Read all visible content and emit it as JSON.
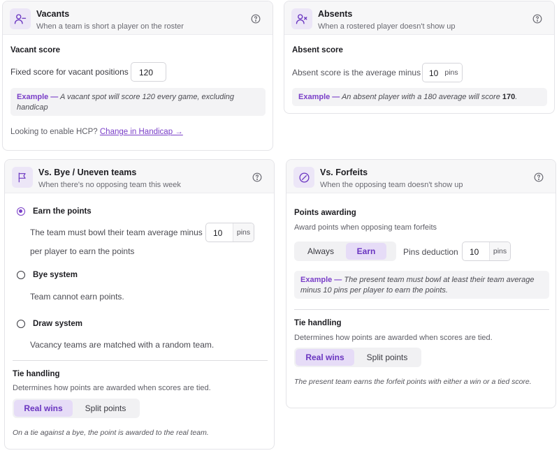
{
  "vacants": {
    "title": "Vacants",
    "subtitle": "When a team is short a player on the roster",
    "icon": "user-minus-icon",
    "section_label": "Vacant score",
    "fixed_label": "Fixed score for vacant positions",
    "fixed_value": "120",
    "example_key": "Example —",
    "example_text": "A vacant spot will score 120 every game, excluding handicap",
    "hcp_text": "Looking to enable HCP?",
    "hcp_link": "Change in Handicap →"
  },
  "absents": {
    "title": "Absents",
    "subtitle": "When a rostered player doesn't show up",
    "icon": "user-x-icon",
    "section_label": "Absent score",
    "minus_label": "Absent score is the average minus",
    "minus_value": "10",
    "unit": "pins",
    "example_key": "Example —",
    "example_text_pre": "An absent player with a 180 average will score",
    "example_value": "170",
    "example_text_post": "."
  },
  "bye": {
    "title": "Vs. Bye / Uneven teams",
    "subtitle": "When there's no opposing team this week",
    "icon": "flag-icon",
    "options": [
      {
        "label": "Earn the points",
        "selected": true
      },
      {
        "label": "Bye system",
        "selected": false
      },
      {
        "label": "Draw system",
        "selected": false
      }
    ],
    "earn_desc_pre": "The team must bowl their team average minus",
    "earn_value": "10",
    "unit": "pins",
    "earn_desc_post": "per player to earn the points",
    "bye_desc": "Team cannot earn points.",
    "draw_desc": "Vacancy teams are matched with a random team.",
    "tie_label": "Tie handling",
    "tie_desc": "Determines how points are awarded when scores are tied.",
    "tie_options": [
      "Real wins",
      "Split points"
    ],
    "tie_selected": "Real wins",
    "tie_note": "On a tie against a bye, the point is awarded to the real team."
  },
  "forfeits": {
    "title": "Vs. Forfeits",
    "subtitle": "When the opposing team doesn't show up",
    "icon": "slash-circle-icon",
    "awarding_label": "Points awarding",
    "awarding_desc": "Award points when opposing team forfeits",
    "awarding_options": [
      "Always",
      "Earn"
    ],
    "awarding_selected": "Earn",
    "deduction_label": "Pins deduction",
    "deduction_value": "10",
    "unit": "pins",
    "example_key": "Example —",
    "example_text": "The present team must bowl at least their team average minus 10 pins per player to earn the points.",
    "tie_label": "Tie handling",
    "tie_desc": "Determines how points are awarded when scores are tied.",
    "tie_options": [
      "Real wins",
      "Split points"
    ],
    "tie_selected": "Real wins",
    "tie_note": "The present team earns the forfeit points with either a win or a tied score."
  },
  "colors": {
    "accent": "#7a3fc8",
    "accent_soft": "#e6dcf7",
    "icon_bg": "#ece6f7"
  }
}
